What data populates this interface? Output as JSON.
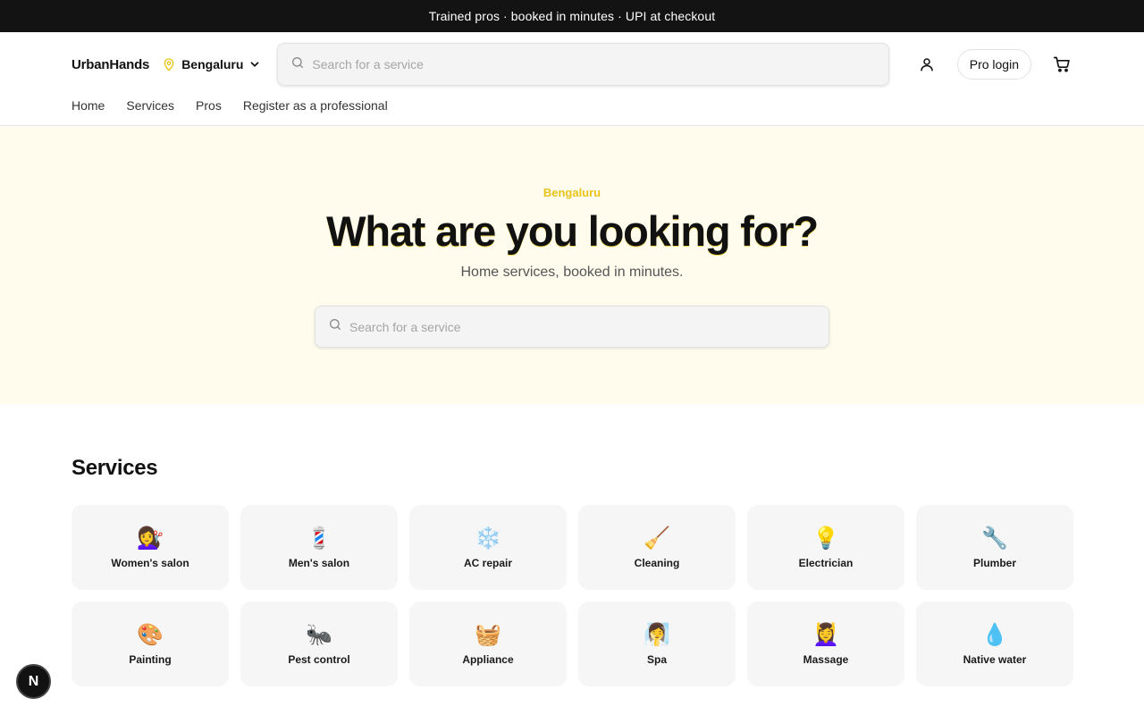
{
  "announcement": "Trained pros · booked in minutes · UPI at checkout",
  "header": {
    "logo": "UrbanHands",
    "city": "Bengaluru",
    "search_placeholder": "Search for a service",
    "pro_login_label": "Pro login"
  },
  "nav": {
    "items": [
      {
        "label": "Home"
      },
      {
        "label": "Services"
      },
      {
        "label": "Pros"
      },
      {
        "label": "Register as a professional"
      }
    ]
  },
  "hero": {
    "city": "Bengaluru",
    "title": "What are you looking for?",
    "subtitle": "Home services, booked in minutes.",
    "search_placeholder": "Search for a service"
  },
  "services": {
    "title": "Services",
    "items": [
      {
        "label": "Women's salon",
        "icon": "💇‍♀️",
        "icon_name": "woman-haircut-icon"
      },
      {
        "label": "Men's salon",
        "icon": "💈",
        "icon_name": "barber-pole-icon"
      },
      {
        "label": "AC repair",
        "icon": "❄️",
        "icon_name": "snowflake-icon"
      },
      {
        "label": "Cleaning",
        "icon": "🧹",
        "icon_name": "broom-icon"
      },
      {
        "label": "Electrician",
        "icon": "💡",
        "icon_name": "light-bulb-icon"
      },
      {
        "label": "Plumber",
        "icon": "🔧",
        "icon_name": "wrench-icon"
      },
      {
        "label": "Painting",
        "icon": "🎨",
        "icon_name": "palette-icon"
      },
      {
        "label": "Pest control",
        "icon": "🐜",
        "icon_name": "ant-icon"
      },
      {
        "label": "Appliance",
        "icon": "🧺",
        "icon_name": "basket-icon"
      },
      {
        "label": "Spa",
        "icon": "🧖‍♀️",
        "icon_name": "woman-in-steam-icon"
      },
      {
        "label": "Massage",
        "icon": "💆‍♀️",
        "icon_name": "woman-massage-icon"
      },
      {
        "label": "Native water",
        "icon": "💧",
        "icon_name": "droplet-icon"
      }
    ]
  },
  "badge": {
    "label": "N"
  },
  "colors": {
    "announce_bg": "#131313",
    "hero_bg": "#fffcee",
    "accent_yellow": "#e8c41a",
    "card_bg": "#f6f6f6"
  }
}
